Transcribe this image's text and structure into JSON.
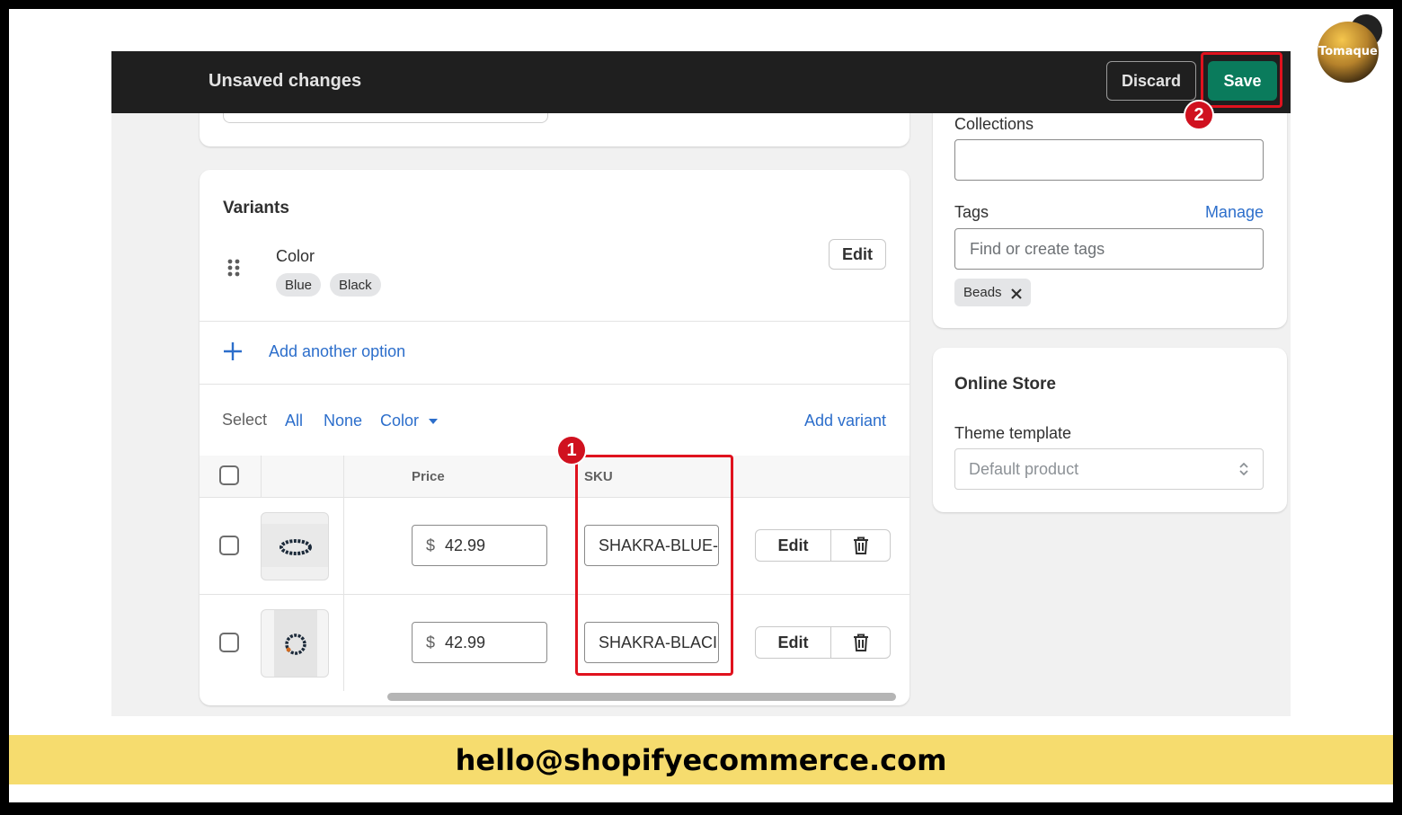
{
  "topbar": {
    "title": "Unsaved changes",
    "discard_label": "Discard",
    "save_label": "Save"
  },
  "annotations": {
    "badge1": "1",
    "badge2": "2"
  },
  "logo": {
    "text": "Tomaque"
  },
  "variants": {
    "heading": "Variants",
    "option_name": "Color",
    "option_values": [
      "Blue",
      "Black"
    ],
    "edit_label": "Edit",
    "add_option_label": "Add another option",
    "select_label": "Select",
    "select_all": "All",
    "select_none": "None",
    "select_color": "Color",
    "add_variant_label": "Add variant",
    "columns": {
      "price": "Price",
      "sku": "SKU"
    },
    "rows": [
      {
        "currency": "$",
        "price": "42.99",
        "sku": "SHAKRA-BLUE-",
        "edit": "Edit"
      },
      {
        "currency": "$",
        "price": "42.99",
        "sku": "SHAKRA-BLACI",
        "edit": "Edit"
      }
    ]
  },
  "sidebar": {
    "collections_label": "Collections",
    "collections_value": "",
    "tags_label": "Tags",
    "manage_label": "Manage",
    "tags_placeholder": "Find or create tags",
    "tag_chips": [
      "Beads"
    ]
  },
  "online_store": {
    "heading": "Online Store",
    "theme_label": "Theme template",
    "theme_value": "Default product"
  },
  "banner": {
    "text": "hello@shopifyecommerce.com"
  },
  "colors": {
    "save": "#0a7b5c",
    "highlight": "#e0121e",
    "link": "#2c6ecb",
    "banner": "#f6dc6e"
  }
}
